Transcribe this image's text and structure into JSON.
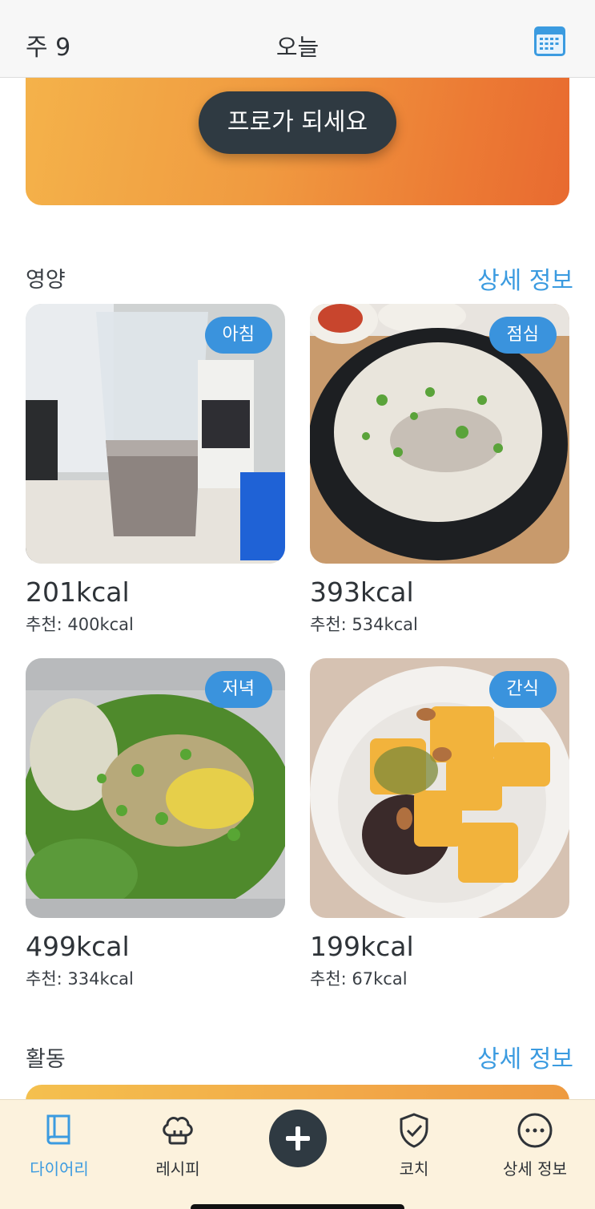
{
  "header": {
    "week": "주 9",
    "title": "오늘",
    "calendar_icon": "calendar-icon"
  },
  "banner": {
    "button_label": "프로가 되세요"
  },
  "nutrition": {
    "title": "영양",
    "link": "상세 정보",
    "meals": [
      {
        "badge": "아침",
        "kcal": "201kcal",
        "recommended": "추천: 400kcal",
        "photo": "protein shake cup"
      },
      {
        "badge": "점심",
        "kcal": "393kcal",
        "recommended": "추천: 534kcal",
        "photo": "beef bone soup"
      },
      {
        "badge": "저녁",
        "kcal": "499kcal",
        "recommended": "추천: 334kcal",
        "photo": "salad"
      },
      {
        "badge": "간식",
        "kcal": "199kcal",
        "recommended": "추천: 67kcal",
        "photo": "yogurt bowl"
      }
    ]
  },
  "activity": {
    "title": "활동",
    "link": "상세 정보"
  },
  "tabbar": {
    "items": [
      {
        "label": "다이어리",
        "icon": "book-icon",
        "active": true
      },
      {
        "label": "레시피",
        "icon": "chef-hat-icon",
        "active": false
      },
      {
        "label": "",
        "icon": "plus-icon",
        "active": false
      },
      {
        "label": "코치",
        "icon": "shield-check-icon",
        "active": false
      },
      {
        "label": "상세 정보",
        "icon": "more-icon",
        "active": false
      }
    ]
  },
  "colors": {
    "accent": "#3b9be0",
    "dark": "#2f3a42",
    "banner": "#ef8b3a",
    "tabbar_bg": "#fcf2dd"
  }
}
